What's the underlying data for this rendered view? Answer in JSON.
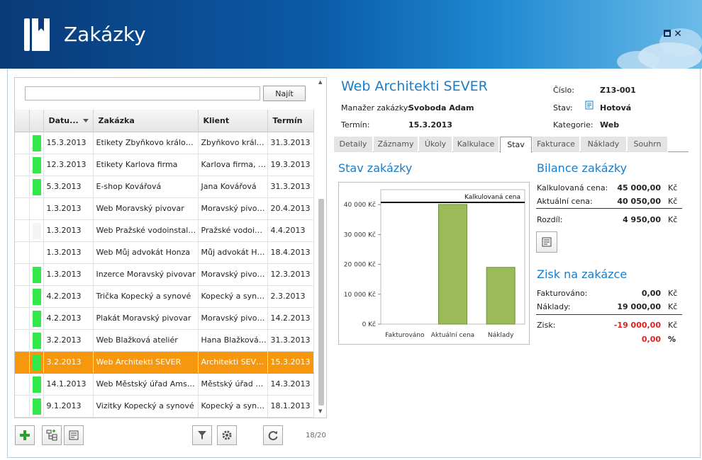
{
  "header": {
    "title": "Zakázky",
    "maximize_icon": "maximize-icon",
    "close_icon": "close-icon"
  },
  "search": {
    "value": "",
    "button_label": "Najít"
  },
  "grid": {
    "columns": [
      "Datu...",
      "Zakázka",
      "Klient",
      "Termín"
    ],
    "rows": [
      {
        "status": "#33e94a",
        "date": "15.3.2013",
        "name": "Etikety Zbyňkovo království",
        "client": "Zbyňkovo králov...",
        "term": "31.3.2013"
      },
      {
        "status": "#33e94a",
        "date": "12.3.2013",
        "name": "Etikety Karlova firma",
        "client": "Karlova firma, s....",
        "term": "19.3.2013"
      },
      {
        "status": "#33e94a",
        "date": "5.3.2013",
        "name": "E-shop Kovářová",
        "client": "Jana Kovářová",
        "term": "31.3.2013"
      },
      {
        "status": "",
        "date": "1.3.2013",
        "name": "Web Moravský pivovar",
        "client": "Moravský pivov...",
        "term": "20.4.2013"
      },
      {
        "status": "#f4f4f4",
        "date": "1.3.2013",
        "name": "Web Pražské vodoinstalace",
        "client": "Pražské vodoins...",
        "term": "4.4.2013"
      },
      {
        "status": "",
        "date": "1.3.2013",
        "name": "Web Můj advokát Honza",
        "client": "Můj advokát Honza",
        "term": "18.4.2013"
      },
      {
        "status": "#33e94a",
        "date": "1.3.2013",
        "name": "Inzerce Moravský pivovar",
        "client": "Moravský pivov...",
        "term": "12.3.2013"
      },
      {
        "status": "#33e94a",
        "date": "4.2.2013",
        "name": "Trička Kopecký a synové",
        "client": "Kopecký a synové",
        "term": "2.3.2013"
      },
      {
        "status": "#33e94a",
        "date": "4.2.2013",
        "name": "Plakát Moravský pivovar",
        "client": "Moravský pivov...",
        "term": "14.2.2013"
      },
      {
        "status": "#33e94a",
        "date": "3.2.2013",
        "name": "Web Blažková ateliér",
        "client": "Hana Blažková - ...",
        "term": "31.3.2013"
      },
      {
        "status": "#33e94a",
        "date": "3.2.2013",
        "name": "Web Architekti SEVER",
        "client": "Architekti SEVER...",
        "term": "15.3.2013",
        "selected": true
      },
      {
        "status": "#33e94a",
        "date": "14.1.2013",
        "name": "Web Městský úřad Amster...",
        "client": "Městský úřad A...",
        "term": "14.3.2013"
      },
      {
        "status": "#33e94a",
        "date": "9.1.2013",
        "name": "Vizitky Kopecký a synové",
        "client": "Kopecký a synové",
        "term": "18.1.2013"
      }
    ]
  },
  "toolbar": {
    "page_count": "18/20"
  },
  "detail": {
    "title": "Web Architekti SEVER",
    "manager_label": "Manažer zakázky:",
    "manager_value": "Svoboda Adam",
    "term_label": "Termín:",
    "term_value": "15.3.2013",
    "number_label": "Číslo:",
    "number_value": "Z13-001",
    "state_label": "Stav:",
    "state_value": "Hotová",
    "category_label": "Kategorie:",
    "category_value": "Web"
  },
  "tabs": [
    "Detaily",
    "Záznamy",
    "Úkoly",
    "Kalkulace",
    "Stav",
    "Fakturace",
    "Náklady",
    "Souhrn"
  ],
  "active_tab": "Stav",
  "status_section": {
    "title": "Stav zakázky"
  },
  "chart_data": {
    "type": "bar",
    "categories": [
      "Fakturováno",
      "Aktuální cena",
      "Náklady"
    ],
    "values": [
      0,
      40050,
      19000
    ],
    "ylim": [
      0,
      45000
    ],
    "yticks": [
      0,
      10000,
      20000,
      30000,
      40000
    ],
    "ytick_labels": [
      "0 Kč",
      "10 000 Kč",
      "20 000 Kč",
      "30 000 Kč",
      "40 000 Kč"
    ],
    "reference_line": {
      "label": "Kalkulovaná cena",
      "value": 45000
    },
    "bar_color": "#9bbb59",
    "grid": false
  },
  "balance": {
    "title": "Bilance zakázky",
    "rows": [
      {
        "label": "Kalkulovaná cena:",
        "value": "45 000,00",
        "unit": "Kč"
      },
      {
        "label": "Aktuální cena:",
        "value": "40 050,00",
        "unit": "Kč"
      },
      {
        "label": "Rozdíl:",
        "value": "4 950,00",
        "unit": "Kč"
      }
    ]
  },
  "profit": {
    "title": "Zisk na zakázce",
    "rows": [
      {
        "label": "Fakturováno:",
        "value": "0,00",
        "unit": "Kč"
      },
      {
        "label": "Náklady:",
        "value": "19 000,00",
        "unit": "Kč"
      },
      {
        "label": "Zisk:",
        "value": "-19 000,00",
        "unit": "Kč"
      },
      {
        "label": "",
        "value": "0,00",
        "unit": "%"
      }
    ],
    "negative_color": "#e02020"
  }
}
